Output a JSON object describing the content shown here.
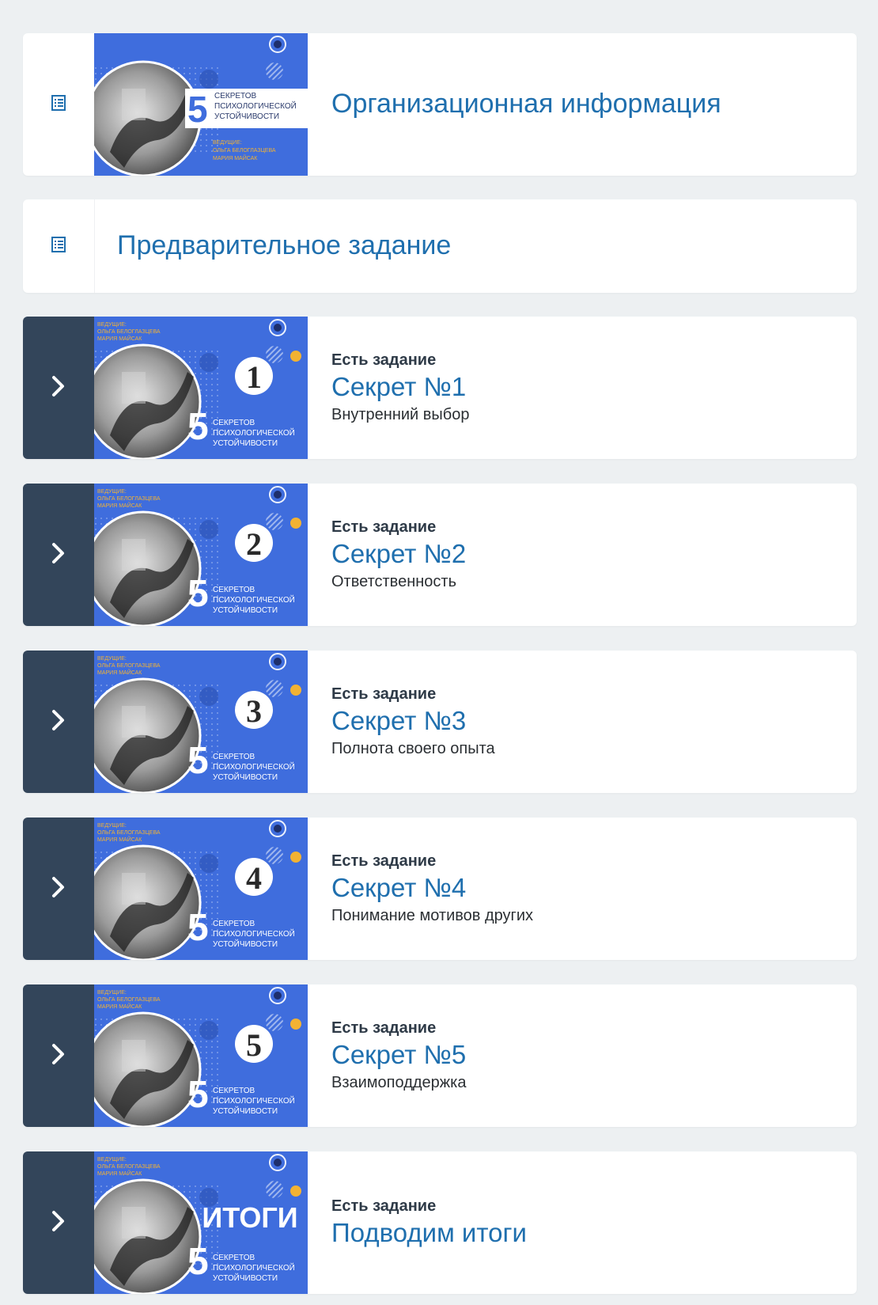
{
  "colors": {
    "page_bg": "#edf0f2",
    "card_bg": "#ffffff",
    "sidebar_dark": "#33455a",
    "title_blue": "#1f6fae",
    "thumb_blue": "#3f6ddd",
    "accent_yellow": "#f2b233"
  },
  "cover": {
    "big_number": "5",
    "line1": "СЕКРЕТОВ",
    "line2": "ПСИХОЛОГИЧЕСКОЙ",
    "line3": "УСТОЙЧИВОСТИ",
    "hosts_label": "ВЕДУЩИЕ:",
    "hosts_line1": "ОЛЬГА БЕЛОГЛАЗЦЕВА",
    "hosts_line2": "МАРИЯ МАЙСАК"
  },
  "items": [
    {
      "kind": "page-with-image",
      "icon": "document-list-icon",
      "title": "Организационная информация"
    },
    {
      "kind": "page",
      "icon": "document-list-icon",
      "title": "Предварительное задание"
    },
    {
      "kind": "section",
      "icon": "chevron-right-icon",
      "badge": "Есть задание",
      "title": "Секрет №1",
      "description": "Внутренний выбор",
      "thumb_number": "1"
    },
    {
      "kind": "section",
      "icon": "chevron-right-icon",
      "badge": "Есть задание",
      "title": "Секрет №2",
      "description": "Ответственность",
      "thumb_number": "2"
    },
    {
      "kind": "section",
      "icon": "chevron-right-icon",
      "badge": "Есть задание",
      "title": "Секрет №3",
      "description": "Полнота своего опыта",
      "thumb_number": "3"
    },
    {
      "kind": "section",
      "icon": "chevron-right-icon",
      "badge": "Есть задание",
      "title": "Секрет №4",
      "description": "Понимание мотивов других",
      "thumb_number": "4"
    },
    {
      "kind": "section",
      "icon": "chevron-right-icon",
      "badge": "Есть задание",
      "title": "Секрет №5",
      "description": "Взаимоподдержка",
      "thumb_number": "5"
    },
    {
      "kind": "section",
      "icon": "chevron-right-icon",
      "badge": "Есть задание",
      "title": "Подводим итоги",
      "thumb_word": "ИТОГИ"
    }
  ]
}
